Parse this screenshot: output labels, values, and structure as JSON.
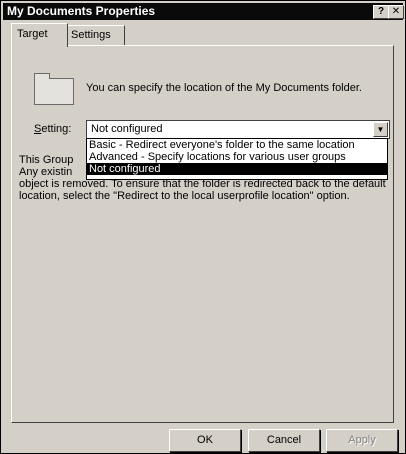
{
  "window": {
    "title": "My Documents Properties",
    "help_label": "?",
    "close_label": "✕",
    "icons": [
      "help-icon",
      "close-icon"
    ]
  },
  "tabs": [
    {
      "label": "Target",
      "active": true
    },
    {
      "label": "Settings",
      "active": false
    }
  ],
  "intro_text": "You can specify the location of the My Documents folder.",
  "setting": {
    "label_prefix": "S",
    "label_rest": "etting:",
    "value": "Not configured",
    "arrow_icon": "chevron-down-icon",
    "options": [
      "Basic - Redirect everyone's folder to the same location",
      "Advanced - Specify locations for various user groups",
      "Not configured"
    ],
    "selected_index": 2
  },
  "description_lines": [
    "This Group",
    "Any existin",
    "object is removed. To ensure that the folder is redirected back to the default",
    "location, select the \"Redirect to the local userprofile location\" option."
  ],
  "buttons": {
    "ok": "OK",
    "cancel": "Cancel",
    "apply": "Apply"
  },
  "colors": {
    "titlebar": "#0a0a0a",
    "face": "#d4d0c8",
    "selection": "#000000"
  }
}
